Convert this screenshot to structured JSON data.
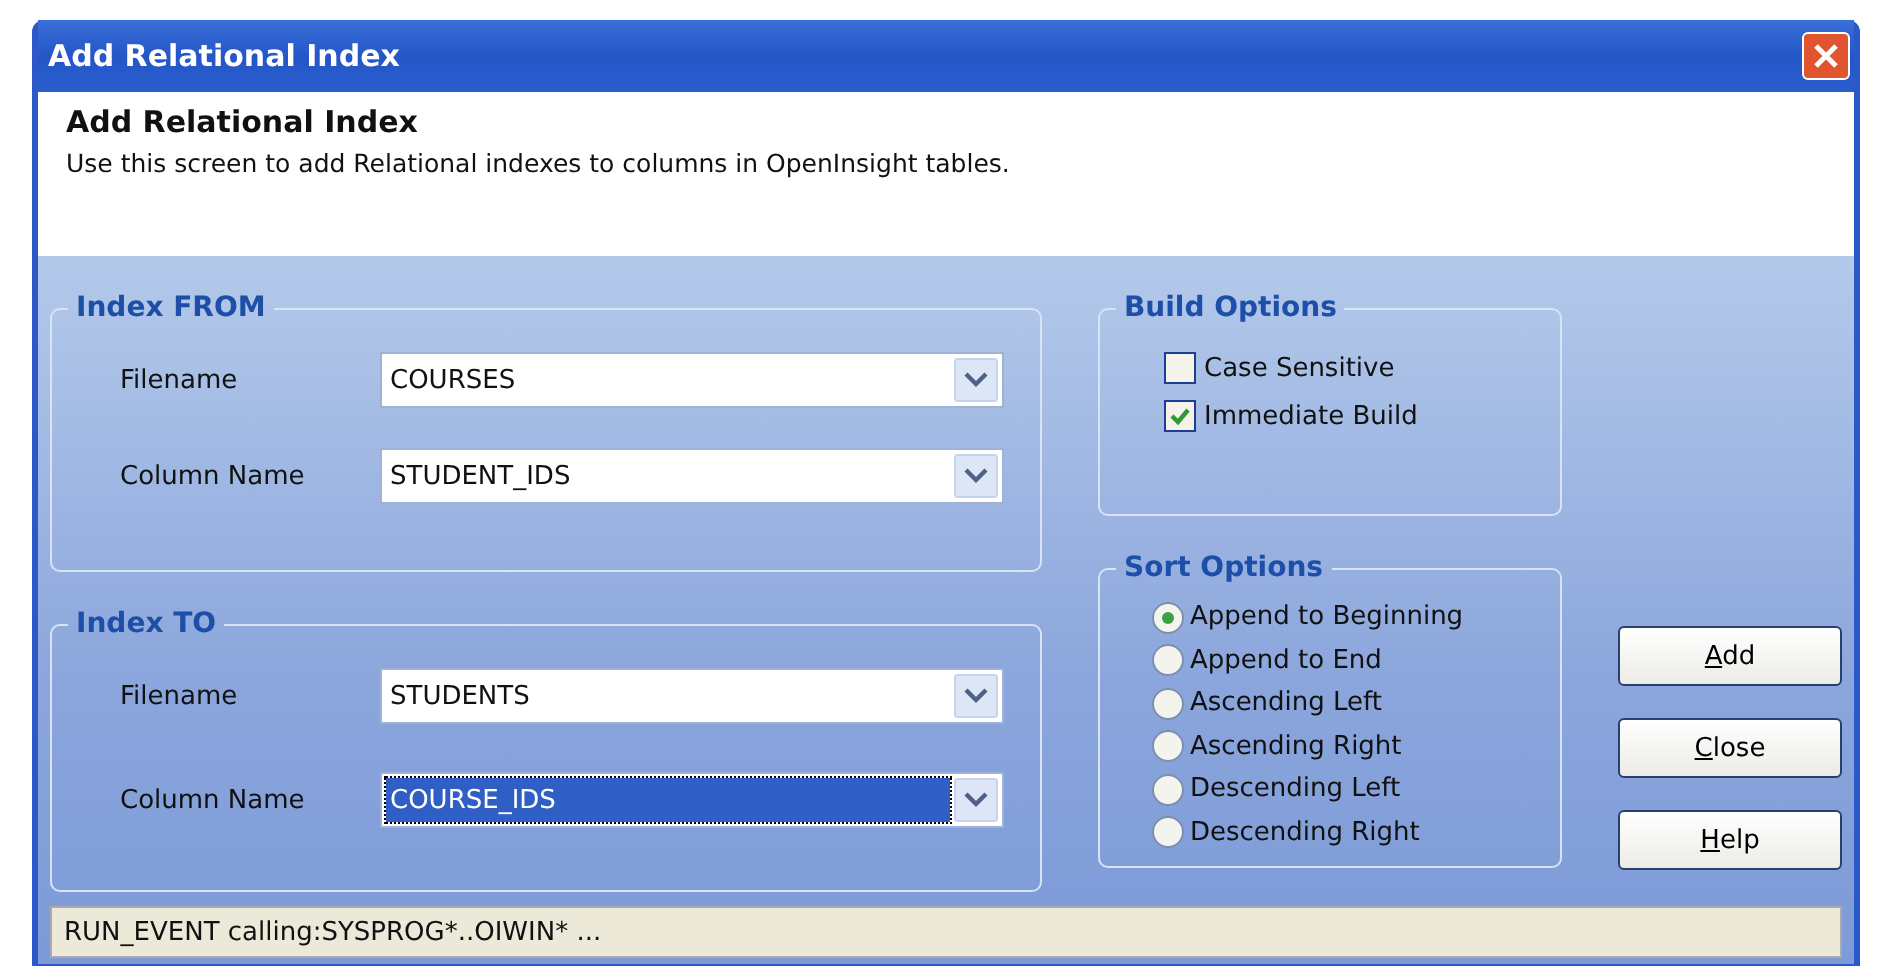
{
  "window": {
    "title": "Add Relational Index"
  },
  "header": {
    "title": "Add Relational Index",
    "description": "Use this screen to add Relational indexes to columns in OpenInsight tables."
  },
  "index_groups": [
    {
      "title": "Index FROM",
      "fields": [
        {
          "label": "Filename",
          "value": "COURSES",
          "focused": false
        },
        {
          "label": "Column Name",
          "value": "STUDENT_IDS",
          "focused": false
        }
      ]
    },
    {
      "title": "Index TO",
      "fields": [
        {
          "label": "Filename",
          "value": "STUDENTS",
          "focused": false
        },
        {
          "label": "Column Name",
          "value": "COURSE_IDS",
          "focused": true
        }
      ]
    }
  ],
  "build_options": {
    "title": "Build Options",
    "items": [
      {
        "label": "Case Sensitive",
        "checked": false
      },
      {
        "label": "Immediate Build",
        "checked": true
      }
    ]
  },
  "sort_options": {
    "title": "Sort Options",
    "items": [
      {
        "label": "Append to Beginning",
        "selected": true
      },
      {
        "label": "Append to End",
        "selected": false
      },
      {
        "label": "Ascending Left",
        "selected": false
      },
      {
        "label": "Ascending Right",
        "selected": false
      },
      {
        "label": "Descending Left",
        "selected": false
      },
      {
        "label": "Descending Right",
        "selected": false
      }
    ]
  },
  "buttons": [
    {
      "label": "Add",
      "mnemonic": true
    },
    {
      "label": "Close",
      "mnemonic": true
    },
    {
      "label": "Help",
      "mnemonic": true
    }
  ],
  "status_bar": "RUN_EVENT calling:SYSPROG*..OIWIN* ..."
}
